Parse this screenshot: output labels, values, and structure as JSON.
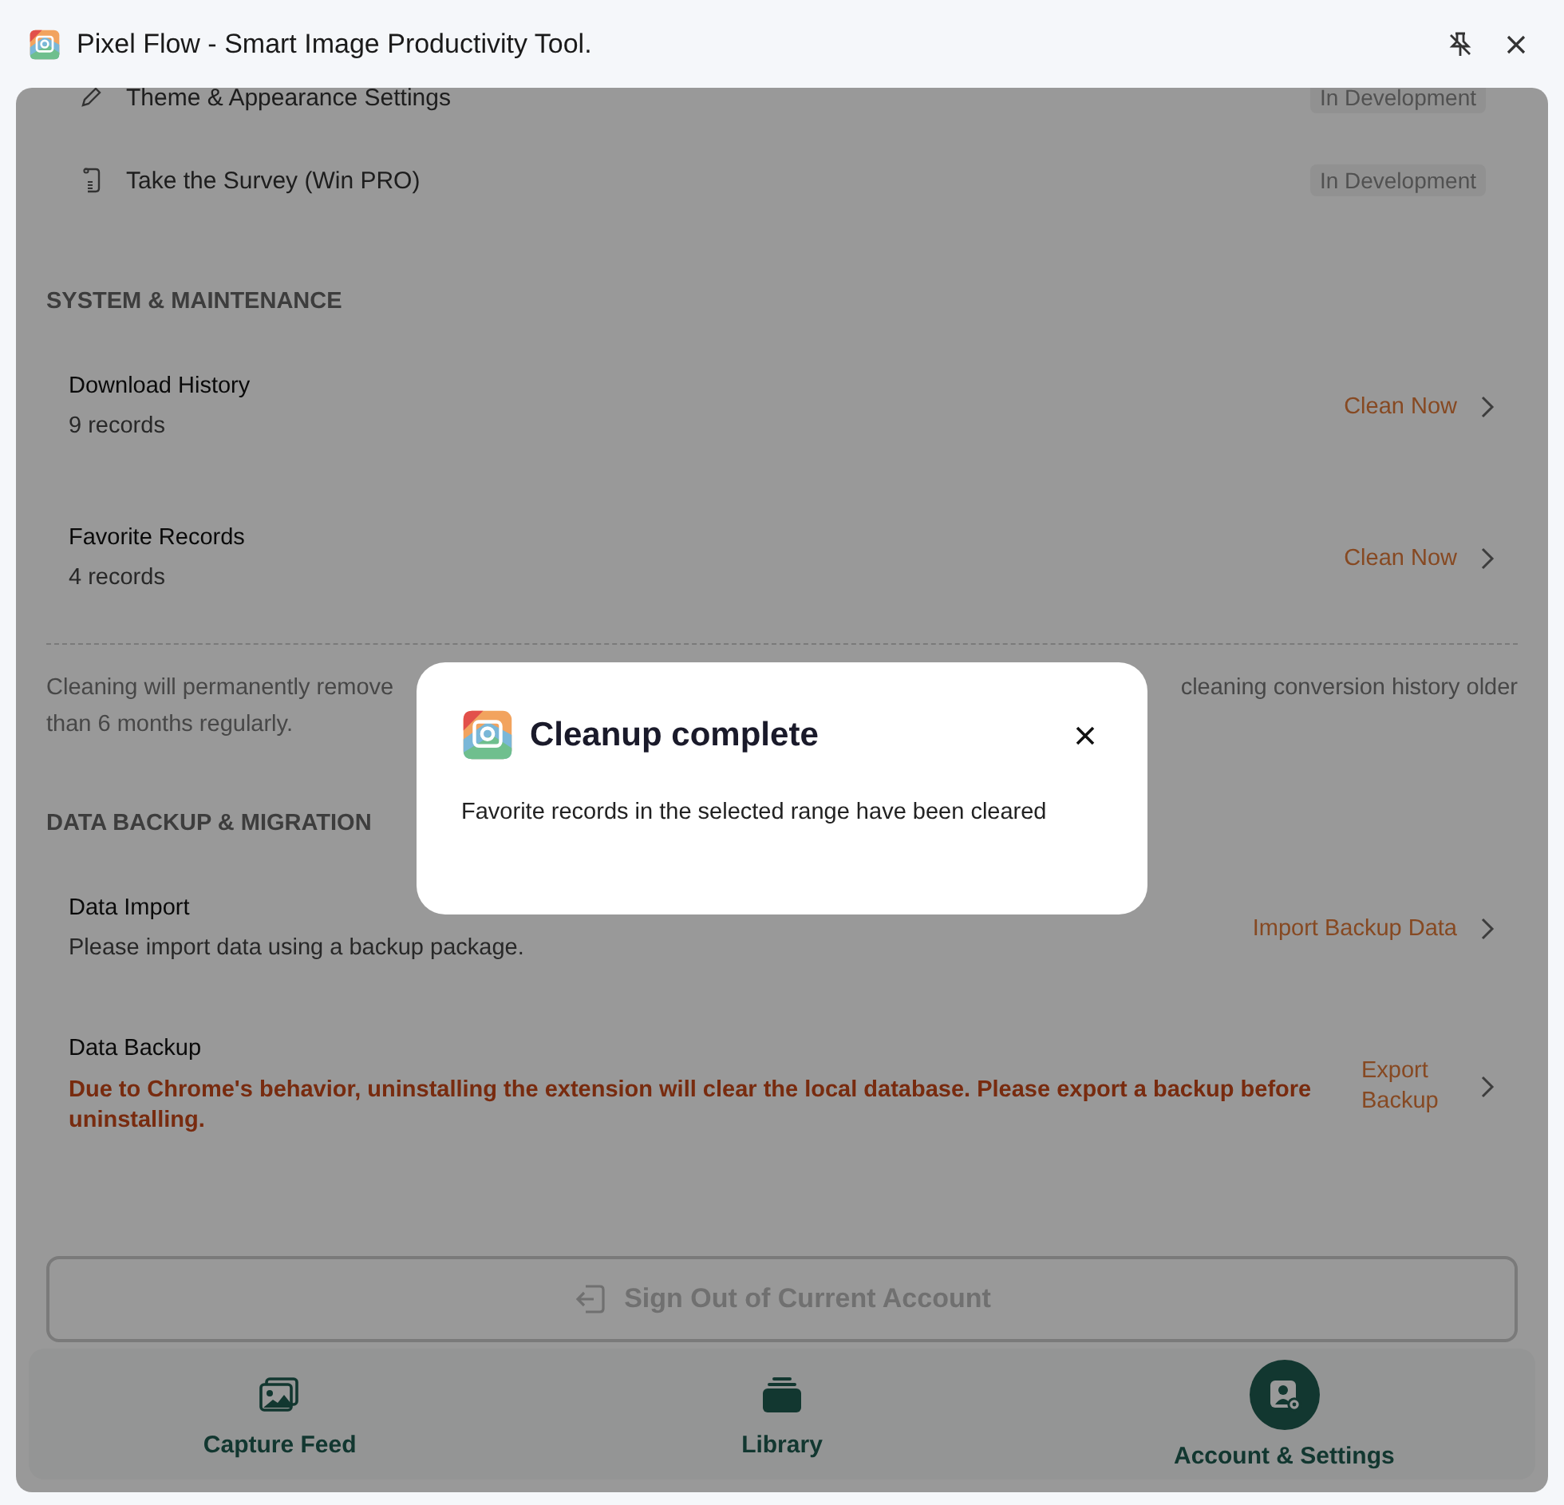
{
  "window": {
    "title": "Pixel Flow - Smart Image Productivity Tool."
  },
  "top_items": [
    {
      "label": "Theme & Appearance Settings",
      "status": "In Development"
    },
    {
      "label": "Take the Survey (Win PRO)",
      "status": "In Development"
    }
  ],
  "sections": [
    {
      "title": "SYSTEM & MAINTENANCE",
      "rows": [
        {
          "kind": "plain",
          "title": "Download History",
          "subtitle": "9 records",
          "action": "Clean Now"
        },
        {
          "kind": "plain",
          "title": "Favorite Records",
          "subtitle": "4 records",
          "action": "Clean Now"
        }
      ],
      "note": {
        "left": "Cleaning will permanently remove",
        "right": "cleaning conversion history older",
        "line_2": "than 6 months regularly."
      }
    },
    {
      "title": "DATA BACKUP & MIGRATION",
      "rows": [
        {
          "kind": "plain",
          "title": "Data Import",
          "subtitle": "Please import data using a backup package.",
          "action": "Import Backup Data"
        },
        {
          "kind": "warning",
          "title": "Data Backup",
          "subtitle": "Due to Chrome's behavior, uninstalling the extension will clear the local database. Please export a backup before uninstalling.",
          "action": "Export Backup"
        }
      ]
    }
  ],
  "sign_out": {
    "label": "Sign Out of Current Account",
    "disabled": true
  },
  "nav": [
    {
      "label": "Capture Feed",
      "selected": false
    },
    {
      "label": "Library",
      "selected": false
    },
    {
      "label": "Account & Settings",
      "selected": true
    }
  ],
  "dialog": {
    "title": "Cleanup complete",
    "message": "Favorite records in the selected range have been cleared"
  }
}
